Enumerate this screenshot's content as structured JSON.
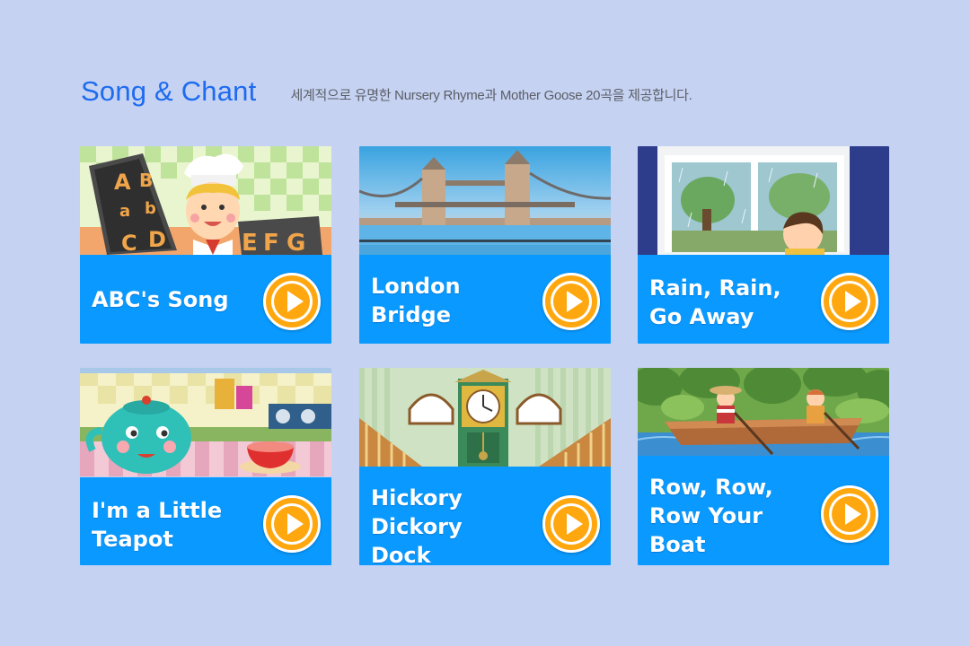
{
  "header": {
    "title": "Song & Chant",
    "subtitle": "세계적으로 유명한 Nursery Rhyme과 Mother Goose 20곡을 제공합니다."
  },
  "cards": [
    {
      "label": "ABC's Song",
      "scene": "alphabet-chef"
    },
    {
      "label": "London\nBridge",
      "scene": "tower-bridge"
    },
    {
      "label": "Rain, Rain,\nGo Away",
      "scene": "rainy-window"
    },
    {
      "label": "I'm a Little\nTeapot",
      "scene": "teapot-kitchen"
    },
    {
      "label": "Hickory\nDickory\nDock",
      "scene": "grandfather-clock"
    },
    {
      "label": "Row, Row,\nRow Your\nBoat",
      "scene": "rowing-boat"
    }
  ],
  "colors": {
    "background": "#c5d2f2",
    "title": "#1e6bf0",
    "card_band": "#0a9aff",
    "play_button": "#ffa70f"
  },
  "icons": {
    "play": "play-icon"
  }
}
